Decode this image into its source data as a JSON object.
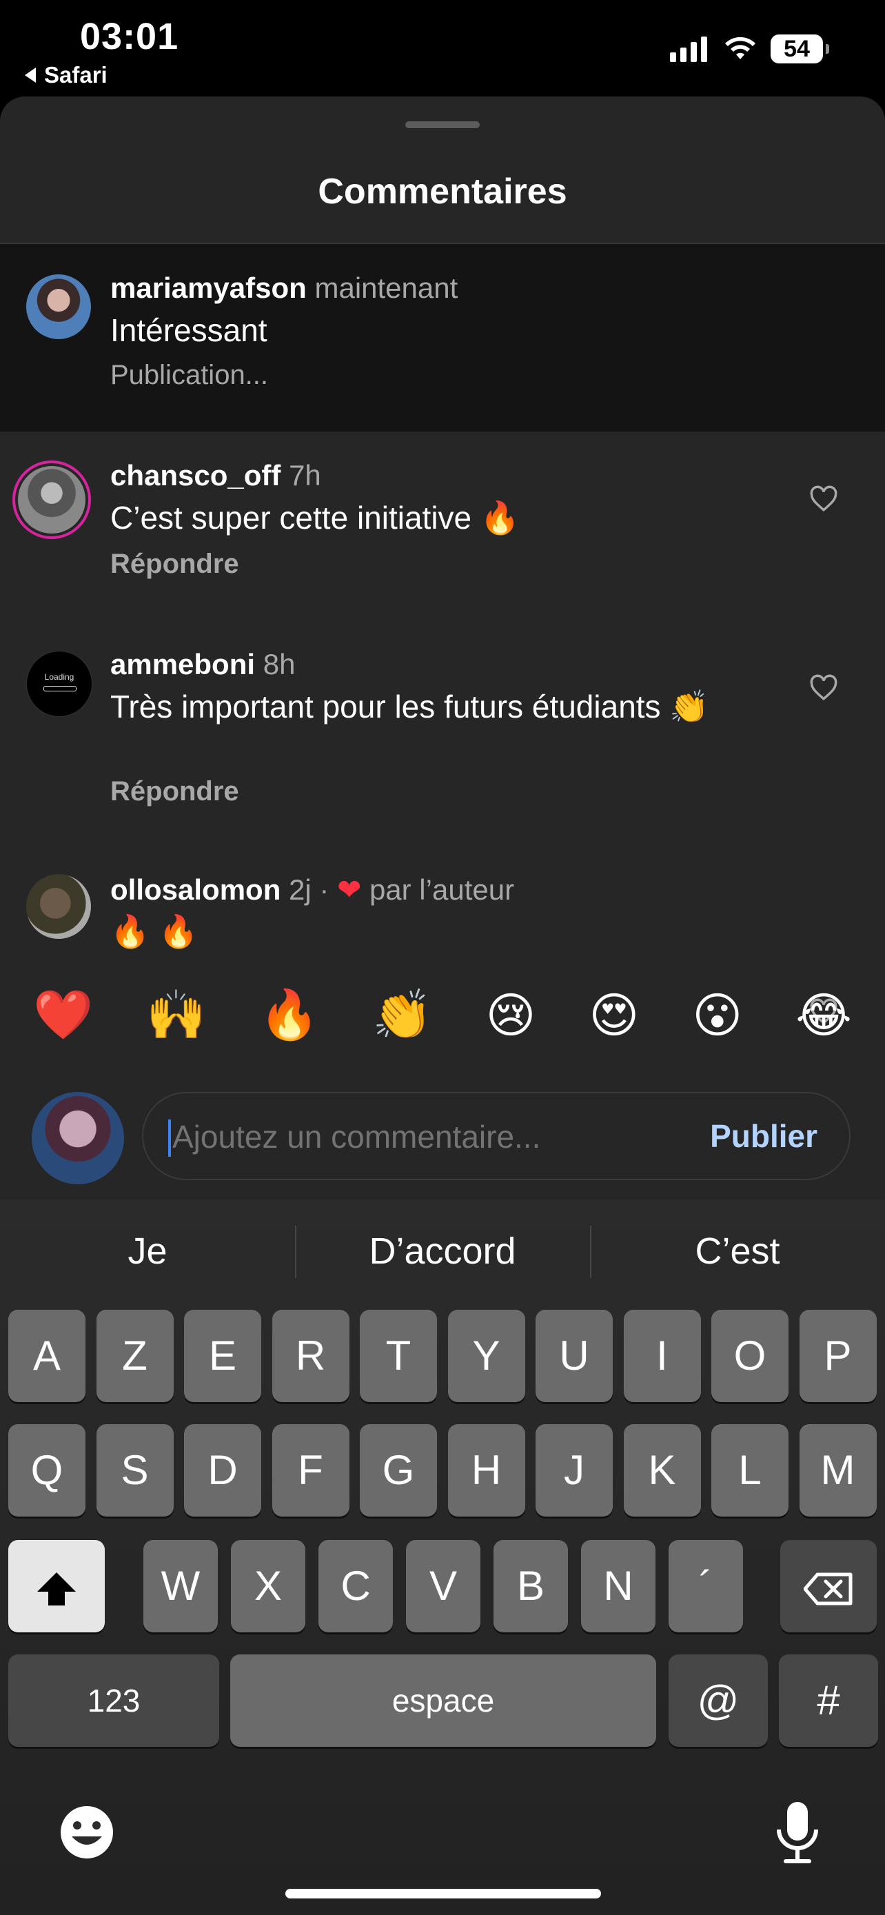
{
  "status_bar": {
    "time": "03:01",
    "back_app": "Safari",
    "battery": "54"
  },
  "sheet": {
    "title": "Commentaires"
  },
  "comments": [
    {
      "username": "mariamyafson",
      "meta": "maintenant",
      "text": "Intéressant",
      "status": "Publication..."
    },
    {
      "username": "chansco_off",
      "meta": "7h",
      "text": "C’est super cette initiative 🔥",
      "reply": "Répondre"
    },
    {
      "username": "ammeboni",
      "meta": "8h",
      "text": "Très important pour les futurs étudiants 👏",
      "reply": "Répondre"
    },
    {
      "username": "ollosalomon",
      "meta": "2j ·",
      "liked_by_author": "par l’auteur",
      "text": "🔥 🔥"
    }
  ],
  "avatar_labels": {
    "ammeboni": "Loading"
  },
  "quick_emojis": [
    "❤️",
    "🙌",
    "🔥",
    "👏",
    "😢",
    "😍",
    "😮",
    "😂"
  ],
  "composer": {
    "placeholder": "Ajoutez un commentaire...",
    "publish_label": "Publier"
  },
  "keyboard": {
    "suggestions": [
      "Je",
      "D’accord",
      "C’est"
    ],
    "row1": [
      "A",
      "Z",
      "E",
      "R",
      "T",
      "Y",
      "U",
      "I",
      "O",
      "P"
    ],
    "row2": [
      "Q",
      "S",
      "D",
      "F",
      "G",
      "H",
      "J",
      "K",
      "L",
      "M"
    ],
    "row3": [
      "W",
      "X",
      "C",
      "V",
      "B",
      "N",
      "´"
    ],
    "numbers_label": "123",
    "space_label": "espace",
    "at_label": "@",
    "hash_label": "#"
  }
}
